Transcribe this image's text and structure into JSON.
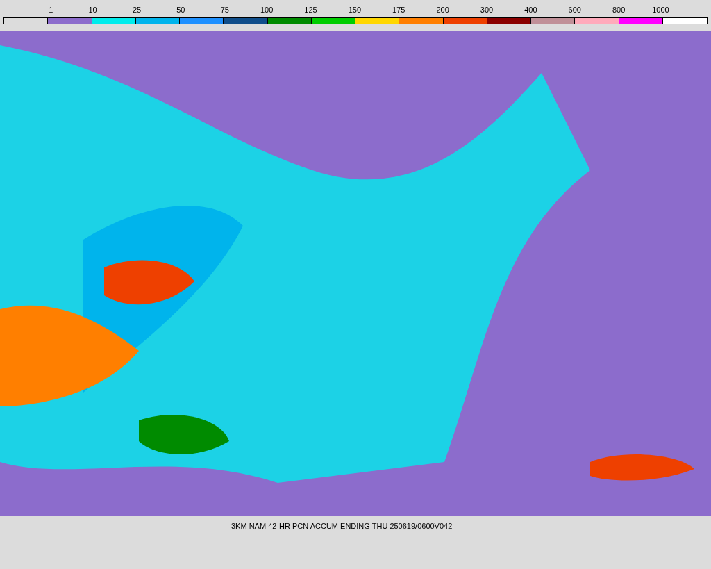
{
  "legend": {
    "labels": [
      "1",
      "10",
      "25",
      "50",
      "75",
      "100",
      "125",
      "150",
      "175",
      "200",
      "300",
      "400",
      "600",
      "800",
      "1000"
    ],
    "swatches": [
      {
        "color": "#dcdcdc"
      },
      {
        "color": "#8c6ccc"
      },
      {
        "color": "#00ecec"
      },
      {
        "color": "#00b4ec"
      },
      {
        "color": "#1e90ff"
      },
      {
        "color": "#104e8b"
      },
      {
        "color": "#008b00"
      },
      {
        "color": "#00cd00"
      },
      {
        "color": "#ffd700"
      },
      {
        "color": "#ff7f00"
      },
      {
        "color": "#ee4000"
      },
      {
        "color": "#8b0000"
      },
      {
        "color": "#c09098"
      },
      {
        "color": "#ffaabb"
      },
      {
        "color": "#ff00ff"
      },
      {
        "color": "#ffffff"
      }
    ]
  },
  "caption": "3KM NAM 42-HR PCN ACCUM ENDING THU 250619/0600V042"
}
